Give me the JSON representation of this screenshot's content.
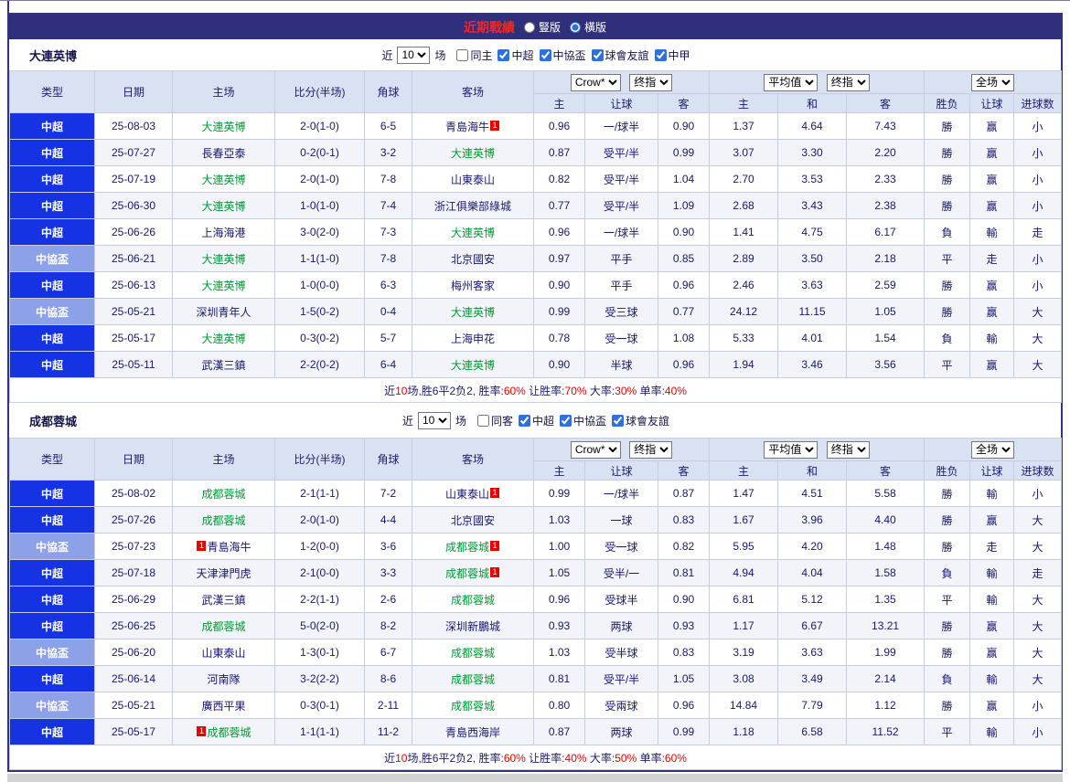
{
  "title_bar": {
    "title": "近期戰績",
    "layout_options": [
      {
        "label": "豎版",
        "selected": false
      },
      {
        "label": "橫版",
        "selected": true
      }
    ]
  },
  "columns": {
    "type": "类型",
    "date": "日期",
    "home": "主场",
    "score": "比分(半场)",
    "corner": "角球",
    "away": "客场",
    "dd_book": "Crow*",
    "dd_final": "终指",
    "dd_avg": "平均值",
    "dd_period": "全场",
    "sub": [
      "主",
      "让球",
      "客",
      "主",
      "和",
      "客",
      "胜负",
      "让球",
      "进球数"
    ]
  },
  "sections": [
    {
      "team": "大連英博",
      "controls": {
        "near_label": "近",
        "count": "10",
        "games_label": "场",
        "checkboxes": [
          {
            "label": "同主",
            "checked": false
          },
          {
            "label": "中超",
            "checked": true
          },
          {
            "label": "中協盃",
            "checked": true
          },
          {
            "label": "球會友誼",
            "checked": true
          },
          {
            "label": "中甲",
            "checked": true
          }
        ]
      },
      "rows": [
        {
          "type": "中超",
          "cup": false,
          "date": "25-08-03",
          "home": "大連英博",
          "home_focus": true,
          "score": "2-0(1-0)",
          "corner": "6-5",
          "away": "青島海牛",
          "away_focus": false,
          "away_badge": "1",
          "away_badge_pos": "after",
          "odds": [
            "0.96",
            "一/球半",
            "0.90"
          ],
          "euro": [
            "1.37",
            "4.64",
            "7.43"
          ],
          "res": [
            [
              "勝",
              "red"
            ],
            [
              "赢",
              "red"
            ],
            [
              "小",
              "green"
            ]
          ]
        },
        {
          "type": "中超",
          "cup": false,
          "date": "25-07-27",
          "home": "長春亞泰",
          "home_focus": false,
          "score": "0-2(0-1)",
          "corner": "3-2",
          "away": "大連英博",
          "away_focus": true,
          "odds": [
            "0.87",
            "受平/半",
            "0.99"
          ],
          "euro": [
            "3.07",
            "3.30",
            "2.20"
          ],
          "res": [
            [
              "勝",
              "red"
            ],
            [
              "赢",
              "red"
            ],
            [
              "小",
              "green"
            ]
          ]
        },
        {
          "type": "中超",
          "cup": false,
          "date": "25-07-19",
          "home": "大連英博",
          "home_focus": true,
          "score": "2-0(1-0)",
          "corner": "7-8",
          "away": "山東泰山",
          "away_focus": false,
          "odds": [
            "0.82",
            "受平/半",
            "1.04"
          ],
          "euro": [
            "2.70",
            "3.53",
            "2.33"
          ],
          "res": [
            [
              "勝",
              "red"
            ],
            [
              "赢",
              "red"
            ],
            [
              "小",
              "green"
            ]
          ]
        },
        {
          "type": "中超",
          "cup": false,
          "date": "25-06-30",
          "home": "大連英博",
          "home_focus": true,
          "score": "1-0(1-0)",
          "corner": "7-4",
          "away": "浙江俱樂部綠城",
          "away_focus": false,
          "odds": [
            "0.77",
            "受平/半",
            "1.09"
          ],
          "euro": [
            "2.68",
            "3.43",
            "2.38"
          ],
          "res": [
            [
              "勝",
              "red"
            ],
            [
              "赢",
              "red"
            ],
            [
              "小",
              "green"
            ]
          ]
        },
        {
          "type": "中超",
          "cup": false,
          "date": "25-06-26",
          "home": "上海海港",
          "home_focus": false,
          "score": "3-0(2-0)",
          "corner": "7-3",
          "away": "大連英博",
          "away_focus": true,
          "odds": [
            "0.96",
            "一/球半",
            "0.90"
          ],
          "euro": [
            "1.41",
            "4.75",
            "6.17"
          ],
          "res": [
            [
              "負",
              "blue"
            ],
            [
              "輸",
              "blue"
            ],
            [
              "走",
              "green"
            ]
          ]
        },
        {
          "type": "中協盃",
          "cup": true,
          "date": "25-06-21",
          "home": "大連英博",
          "home_focus": true,
          "score": "1-1(1-0)",
          "corner": "7-8",
          "away": "北京國安",
          "away_focus": false,
          "odds": [
            "0.97",
            "平手",
            "0.85"
          ],
          "euro": [
            "2.89",
            "3.50",
            "2.18"
          ],
          "res": [
            [
              "平",
              "green"
            ],
            [
              "走",
              "green"
            ],
            [
              "小",
              "green"
            ]
          ]
        },
        {
          "type": "中超",
          "cup": false,
          "date": "25-06-13",
          "home": "大連英博",
          "home_focus": true,
          "score": "1-0(0-0)",
          "corner": "6-3",
          "away": "梅州客家",
          "away_focus": false,
          "odds": [
            "0.90",
            "平手",
            "0.96"
          ],
          "euro": [
            "2.46",
            "3.63",
            "2.59"
          ],
          "res": [
            [
              "勝",
              "red"
            ],
            [
              "赢",
              "red"
            ],
            [
              "小",
              "green"
            ]
          ]
        },
        {
          "type": "中協盃",
          "cup": true,
          "date": "25-05-21",
          "home": "深圳青年人",
          "home_focus": false,
          "score": "1-5(0-2)",
          "corner": "0-4",
          "away": "大連英博",
          "away_focus": true,
          "odds": [
            "0.99",
            "受三球",
            "0.77"
          ],
          "euro": [
            "24.12",
            "11.15",
            "1.05"
          ],
          "res": [
            [
              "勝",
              "red"
            ],
            [
              "赢",
              "red"
            ],
            [
              "大",
              "red"
            ]
          ]
        },
        {
          "type": "中超",
          "cup": false,
          "date": "25-05-17",
          "home": "大連英博",
          "home_focus": true,
          "score": "0-3(0-2)",
          "corner": "5-7",
          "away": "上海申花",
          "away_focus": false,
          "odds": [
            "0.78",
            "受一球",
            "1.08"
          ],
          "euro": [
            "5.33",
            "4.01",
            "1.54"
          ],
          "res": [
            [
              "負",
              "blue"
            ],
            [
              "輸",
              "blue"
            ],
            [
              "大",
              "red"
            ]
          ]
        },
        {
          "type": "中超",
          "cup": false,
          "date": "25-05-11",
          "home": "武漢三鎮",
          "home_focus": false,
          "score": "2-2(0-2)",
          "corner": "6-4",
          "away": "大連英博",
          "away_focus": true,
          "odds": [
            "0.90",
            "半球",
            "0.96"
          ],
          "euro": [
            "1.94",
            "3.46",
            "3.56"
          ],
          "res": [
            [
              "平",
              "green"
            ],
            [
              "赢",
              "red"
            ],
            [
              "大",
              "red"
            ]
          ]
        }
      ],
      "summary": [
        {
          "t": "近"
        },
        {
          "t": "10",
          "red": true
        },
        {
          "t": "场,胜6平2负2, 胜率:"
        },
        {
          "t": "60%",
          "red": true
        },
        {
          "t": " 让胜率:"
        },
        {
          "t": "70%",
          "red": true
        },
        {
          "t": " 大率:"
        },
        {
          "t": "30%",
          "red": true
        },
        {
          "t": " 单率:"
        },
        {
          "t": "40%",
          "red": true
        }
      ]
    },
    {
      "team": "成都蓉城",
      "controls": {
        "near_label": "近",
        "count": "10",
        "games_label": "场",
        "checkboxes": [
          {
            "label": "同客",
            "checked": false
          },
          {
            "label": "中超",
            "checked": true
          },
          {
            "label": "中協盃",
            "checked": true
          },
          {
            "label": "球會友誼",
            "checked": true
          }
        ]
      },
      "rows": [
        {
          "type": "中超",
          "cup": false,
          "date": "25-08-02",
          "home": "成都蓉城",
          "home_focus": true,
          "score": "2-1(1-1)",
          "corner": "7-2",
          "away": "山東泰山",
          "away_focus": false,
          "away_badge": "1",
          "away_badge_pos": "after",
          "odds": [
            "0.99",
            "一/球半",
            "0.87"
          ],
          "euro": [
            "1.47",
            "4.51",
            "5.58"
          ],
          "res": [
            [
              "勝",
              "red"
            ],
            [
              "輸",
              "blue"
            ],
            [
              "小",
              "green"
            ]
          ]
        },
        {
          "type": "中超",
          "cup": false,
          "date": "25-07-26",
          "home": "成都蓉城",
          "home_focus": true,
          "score": "2-0(1-0)",
          "corner": "4-4",
          "away": "北京國安",
          "away_focus": false,
          "odds": [
            "1.03",
            "一球",
            "0.83"
          ],
          "euro": [
            "1.67",
            "3.96",
            "4.40"
          ],
          "res": [
            [
              "勝",
              "red"
            ],
            [
              "赢",
              "red"
            ],
            [
              "大",
              "red"
            ]
          ]
        },
        {
          "type": "中協盃",
          "cup": true,
          "date": "25-07-23",
          "home": "青島海牛",
          "home_focus": false,
          "home_badge": "1",
          "home_badge_pos": "before",
          "score": "1-2(0-0)",
          "corner": "3-6",
          "away": "成都蓉城",
          "away_focus": true,
          "away_badge": "1",
          "away_badge_pos": "after",
          "odds": [
            "1.00",
            "受一球",
            "0.82"
          ],
          "euro": [
            "5.95",
            "4.20",
            "1.48"
          ],
          "res": [
            [
              "勝",
              "red"
            ],
            [
              "走",
              "green"
            ],
            [
              "大",
              "red"
            ]
          ]
        },
        {
          "type": "中超",
          "cup": false,
          "date": "25-07-18",
          "home": "天津津門虎",
          "home_focus": false,
          "score": "2-1(0-0)",
          "corner": "3-3",
          "away": "成都蓉城",
          "away_focus": true,
          "away_badge": "1",
          "away_badge_pos": "after",
          "odds": [
            "1.05",
            "受半/一",
            "0.81"
          ],
          "euro": [
            "4.94",
            "4.04",
            "1.58"
          ],
          "res": [
            [
              "負",
              "blue"
            ],
            [
              "輸",
              "blue"
            ],
            [
              "走",
              "green"
            ]
          ]
        },
        {
          "type": "中超",
          "cup": false,
          "date": "25-06-29",
          "home": "武漢三鎮",
          "home_focus": false,
          "score": "2-2(1-1)",
          "corner": "2-6",
          "away": "成都蓉城",
          "away_focus": true,
          "odds": [
            "0.96",
            "受球半",
            "0.90"
          ],
          "euro": [
            "6.81",
            "5.12",
            "1.35"
          ],
          "res": [
            [
              "平",
              "green"
            ],
            [
              "輸",
              "blue"
            ],
            [
              "大",
              "red"
            ]
          ]
        },
        {
          "type": "中超",
          "cup": false,
          "date": "25-06-25",
          "home": "成都蓉城",
          "home_focus": true,
          "score": "5-0(2-0)",
          "corner": "8-2",
          "away": "深圳新鵬城",
          "away_focus": false,
          "odds": [
            "0.93",
            "两球",
            "0.93"
          ],
          "euro": [
            "1.17",
            "6.67",
            "13.21"
          ],
          "res": [
            [
              "勝",
              "red"
            ],
            [
              "赢",
              "red"
            ],
            [
              "大",
              "red"
            ]
          ]
        },
        {
          "type": "中協盃",
          "cup": true,
          "date": "25-06-20",
          "home": "山東泰山",
          "home_focus": false,
          "score": "1-3(0-1)",
          "corner": "6-7",
          "away": "成都蓉城",
          "away_focus": true,
          "odds": [
            "1.03",
            "受半球",
            "0.83"
          ],
          "euro": [
            "3.19",
            "3.63",
            "1.99"
          ],
          "res": [
            [
              "勝",
              "red"
            ],
            [
              "赢",
              "red"
            ],
            [
              "大",
              "red"
            ]
          ]
        },
        {
          "type": "中超",
          "cup": false,
          "date": "25-06-14",
          "home": "河南隊",
          "home_focus": false,
          "score": "3-2(2-2)",
          "corner": "8-6",
          "away": "成都蓉城",
          "away_focus": true,
          "odds": [
            "0.81",
            "受平/半",
            "1.05"
          ],
          "euro": [
            "3.08",
            "3.49",
            "2.14"
          ],
          "res": [
            [
              "負",
              "blue"
            ],
            [
              "輸",
              "blue"
            ],
            [
              "大",
              "red"
            ]
          ]
        },
        {
          "type": "中協盃",
          "cup": true,
          "date": "25-05-21",
          "home": "廣西平果",
          "home_focus": false,
          "score": "0-3(0-1)",
          "corner": "2-11",
          "away": "成都蓉城",
          "away_focus": true,
          "odds": [
            "0.80",
            "受兩球",
            "0.96"
          ],
          "euro": [
            "14.84",
            "7.79",
            "1.12"
          ],
          "res": [
            [
              "勝",
              "red"
            ],
            [
              "赢",
              "red"
            ],
            [
              "小",
              "green"
            ]
          ]
        },
        {
          "type": "中超",
          "cup": false,
          "date": "25-05-17",
          "home": "成都蓉城",
          "home_focus": true,
          "home_badge": "1",
          "home_badge_pos": "before",
          "score": "1-1(1-1)",
          "corner": "11-2",
          "away": "青島西海岸",
          "away_focus": false,
          "odds": [
            "0.87",
            "两球",
            "0.99"
          ],
          "euro": [
            "1.18",
            "6.58",
            "11.52"
          ],
          "res": [
            [
              "平",
              "green"
            ],
            [
              "輸",
              "blue"
            ],
            [
              "小",
              "green"
            ]
          ]
        }
      ],
      "summary": [
        {
          "t": "近"
        },
        {
          "t": "10",
          "red": true
        },
        {
          "t": "场,胜6平2负2, 胜率:"
        },
        {
          "t": "60%",
          "red": true
        },
        {
          "t": " 让胜率:"
        },
        {
          "t": "40%",
          "red": true
        },
        {
          "t": " 大率:"
        },
        {
          "t": "50%",
          "red": true
        },
        {
          "t": " 单率:"
        },
        {
          "t": "60%",
          "red": true
        }
      ]
    }
  ]
}
